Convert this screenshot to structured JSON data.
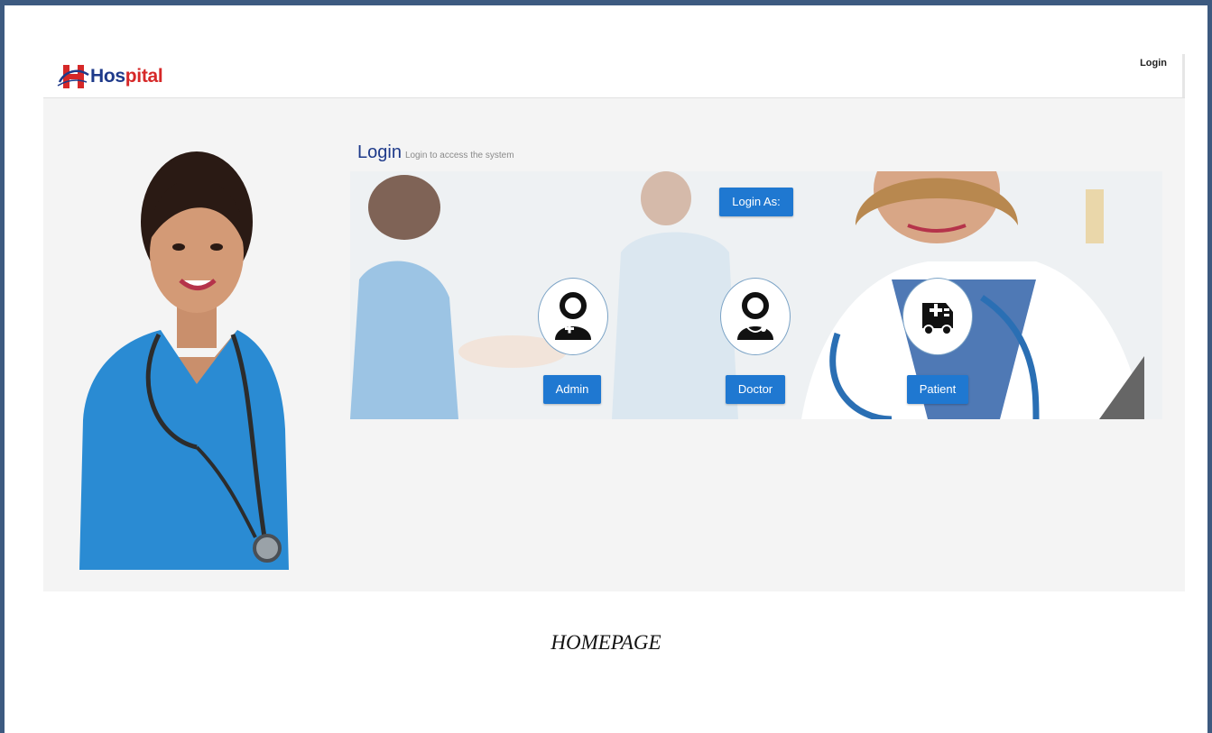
{
  "navbar": {
    "brand_prefix": "H",
    "brand_name_blue": "Hos",
    "brand_name_red": "pital",
    "login_link": "Login"
  },
  "main": {
    "heading": "Login",
    "subheading": "Login to access the system",
    "login_as_label": "Login As:",
    "roles": [
      {
        "label": "Admin",
        "icon": "admin-user-icon"
      },
      {
        "label": "Doctor",
        "icon": "doctor-user-icon"
      },
      {
        "label": "Patient",
        "icon": "ambulance-icon"
      }
    ]
  },
  "caption": "HOMEPAGE",
  "colors": {
    "accent": "#1f78d1",
    "brand_blue": "#1e3a8a",
    "brand_red": "#d62828",
    "frame": "#3d5a80"
  }
}
